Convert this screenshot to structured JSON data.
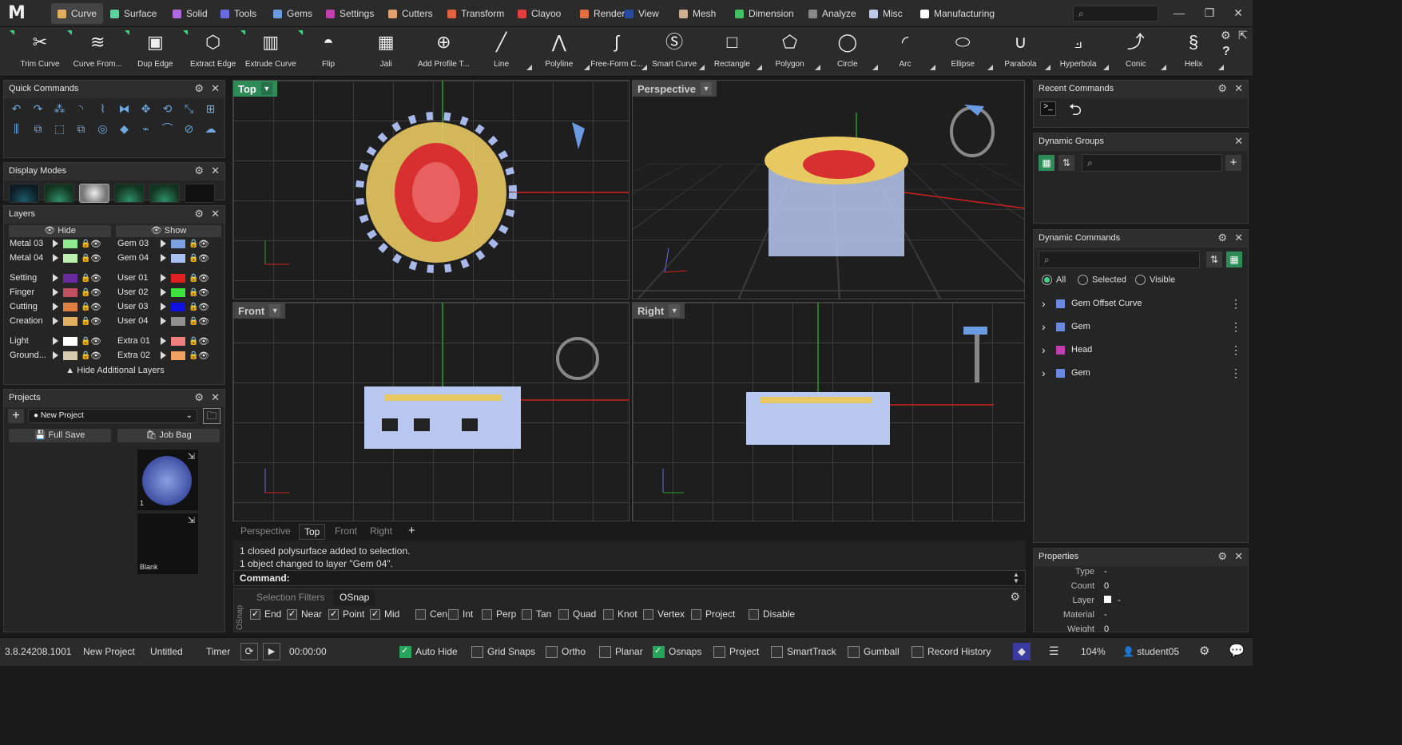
{
  "app": {
    "logo": "M",
    "version": "3.8.24208.1001"
  },
  "menu_tabs": [
    {
      "label": "Curve",
      "color": "#e0b060",
      "active": true
    },
    {
      "label": "Surface",
      "color": "#5fd0a0"
    },
    {
      "label": "Solid",
      "color": "#b06ae0"
    },
    {
      "label": "Tools",
      "color": "#6a6ae0"
    },
    {
      "label": "Gems",
      "color": "#6a9ae0"
    },
    {
      "label": "Settings",
      "color": "#c040b0"
    },
    {
      "label": "Cutters",
      "color": "#e0a070"
    },
    {
      "label": "Transform",
      "color": "#e06040"
    },
    {
      "label": "Clayoo",
      "color": "#e04040"
    },
    {
      "label": "Render",
      "color": "#e07040"
    },
    {
      "label": "View",
      "color": "#2a4aa0"
    },
    {
      "label": "Mesh",
      "color": "#d0b090"
    },
    {
      "label": "Dimension",
      "color": "#40c060"
    },
    {
      "label": "Analyze",
      "color": "#888888"
    },
    {
      "label": "Misc",
      "color": "#c0c8e8"
    },
    {
      "label": "Manufacturing",
      "color": "#ffffff"
    }
  ],
  "tools": [
    {
      "label": "Trim Curve",
      "icon": "trim-curve-icon",
      "glyph": "✂"
    },
    {
      "label": "Curve From...",
      "icon": "curve-from-icon",
      "glyph": "≋"
    },
    {
      "label": "Dup Edge",
      "icon": "dup-edge-icon",
      "glyph": "▣"
    },
    {
      "label": "Extract Edge",
      "icon": "extract-edge-icon",
      "glyph": "⬡"
    },
    {
      "label": "Extrude Curve",
      "icon": "extrude-curve-icon",
      "glyph": "▥"
    },
    {
      "label": "Flip",
      "icon": "flip-icon",
      "glyph": "◓"
    },
    {
      "label": "Jali",
      "icon": "jali-icon",
      "glyph": "▦"
    },
    {
      "label": "Add Profile T...",
      "icon": "add-profile-icon",
      "glyph": "⊕"
    },
    {
      "label": "Line",
      "icon": "line-icon",
      "glyph": "╱"
    },
    {
      "label": "Polyline",
      "icon": "polyline-icon",
      "glyph": "⋀"
    },
    {
      "label": "Free-Form C...",
      "icon": "freeform-curve-icon",
      "glyph": "∫"
    },
    {
      "label": "Smart Curve",
      "icon": "smart-curve-icon",
      "glyph": "Ⓢ"
    },
    {
      "label": "Rectangle",
      "icon": "rectangle-icon",
      "glyph": "□"
    },
    {
      "label": "Polygon",
      "icon": "polygon-icon",
      "glyph": "⬠"
    },
    {
      "label": "Circle",
      "icon": "circle-icon",
      "glyph": "◯"
    },
    {
      "label": "Arc",
      "icon": "arc-icon",
      "glyph": "◜"
    },
    {
      "label": "Ellipse",
      "icon": "ellipse-icon",
      "glyph": "⬭"
    },
    {
      "label": "Parabola",
      "icon": "parabola-icon",
      "glyph": "∪"
    },
    {
      "label": "Hyperbola",
      "icon": "hyperbola-icon",
      "glyph": "⟓"
    },
    {
      "label": "Conic",
      "icon": "conic-icon",
      "glyph": "⤴"
    },
    {
      "label": "Helix",
      "icon": "helix-icon",
      "glyph": "§"
    }
  ],
  "panels": {
    "quick_commands": "Quick Commands",
    "display_modes": "Display Modes",
    "layers": "Layers",
    "projects": "Projects",
    "recent_commands": "Recent Commands",
    "dynamic_groups": "Dynamic Groups",
    "dynamic_commands": "Dynamic Commands",
    "properties": "Properties"
  },
  "layers": {
    "hide_label": "Hide",
    "show_label": "Show",
    "footer": "Hide Additional Layers",
    "left": [
      {
        "name": "Metal 03",
        "color": "#90e890"
      },
      {
        "name": "Metal 04",
        "color": "#c0f0b0"
      },
      {
        "name": "Setting",
        "color": "#6a2aa0"
      },
      {
        "name": "Finger",
        "color": "#c05060"
      },
      {
        "name": "Cutting",
        "color": "#e08040"
      },
      {
        "name": "Creation",
        "color": "#e0b060"
      },
      {
        "name": "Light",
        "color": "#ffffff"
      },
      {
        "name": "Ground...",
        "color": "#d8ccb0"
      }
    ],
    "right": [
      {
        "name": "Gem 03",
        "color": "#7aa0e0"
      },
      {
        "name": "Gem 04",
        "color": "#a8c0f0"
      },
      {
        "name": "User 01",
        "color": "#e02020"
      },
      {
        "name": "User 02",
        "color": "#40e040"
      },
      {
        "name": "User 03",
        "color": "#1010e0"
      },
      {
        "name": "User 04",
        "color": "#909090"
      },
      {
        "name": "Extra 01",
        "color": "#f08080"
      },
      {
        "name": "Extra 02",
        "color": "#f0a060"
      }
    ]
  },
  "projects": {
    "selected": "New Project",
    "full_save": "Full Save",
    "job_bag": "Job Bag",
    "thumb1_label": "1",
    "thumb2_label": "Blank"
  },
  "viewports": {
    "top": "Top",
    "perspective": "Perspective",
    "front": "Front",
    "right": "Right",
    "tabs": [
      "Perspective",
      "Top",
      "Front",
      "Right",
      "+"
    ],
    "active_tab": "Top"
  },
  "command": {
    "log": [
      "1 closed polysurface added to selection.",
      "1 object changed to layer \"Gem 04\"."
    ],
    "prompt": "Command:"
  },
  "osnap": {
    "tabs": [
      "Selection Filters",
      "OSnap"
    ],
    "side_label": "OSnap",
    "items": [
      {
        "label": "End",
        "checked": true
      },
      {
        "label": "Near",
        "checked": true
      },
      {
        "label": "Point",
        "checked": true
      },
      {
        "label": "Mid",
        "checked": true
      },
      {
        "label": "Cen",
        "checked": false
      },
      {
        "label": "Int",
        "checked": false
      },
      {
        "label": "Perp",
        "checked": false
      },
      {
        "label": "Tan",
        "checked": false
      },
      {
        "label": "Quad",
        "checked": false
      },
      {
        "label": "Knot",
        "checked": false
      },
      {
        "label": "Vertex",
        "checked": false
      },
      {
        "label": "Project",
        "checked": false
      },
      {
        "label": "Disable",
        "checked": false
      }
    ]
  },
  "dynamic_commands": {
    "filters": [
      "All",
      "Selected",
      "Visible"
    ],
    "selected_filter": "All",
    "items": [
      {
        "label": "Gem Offset Curve",
        "color": "#6a8ae0"
      },
      {
        "label": "Gem",
        "color": "#6a8ae0"
      },
      {
        "label": "Head",
        "color": "#c040b0"
      },
      {
        "label": "Gem",
        "color": "#6a8ae0"
      }
    ]
  },
  "properties": {
    "rows": [
      {
        "key": "Type",
        "value": "-"
      },
      {
        "key": "Count",
        "value": "0"
      },
      {
        "key": "Layer",
        "value": "-"
      },
      {
        "key": "Material",
        "value": "-"
      },
      {
        "key": "Weight",
        "value": "0"
      }
    ]
  },
  "status": {
    "project": "New Project",
    "file": "Untitled",
    "timer_label": "Timer",
    "timer_value": "00:00:00",
    "toggles": [
      {
        "label": "Auto Hide",
        "checked": true
      },
      {
        "label": "Grid Snaps",
        "checked": false
      },
      {
        "label": "Ortho",
        "checked": false
      },
      {
        "label": "Planar",
        "checked": false
      },
      {
        "label": "Osnaps",
        "checked": true
      },
      {
        "label": "Project",
        "checked": false
      },
      {
        "label": "SmartTrack",
        "checked": false
      },
      {
        "label": "Gumball",
        "checked": false
      },
      {
        "label": "Record History",
        "checked": false
      }
    ],
    "zoom": "104%",
    "user": "student05"
  }
}
